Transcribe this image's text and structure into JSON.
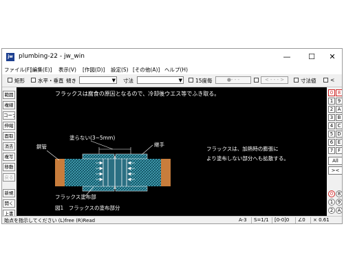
{
  "window": {
    "title": "plumbing-22 - jw_win",
    "icon_label": "jw"
  },
  "window_controls": {
    "minimize": "—",
    "maximize": "☐",
    "close": "✕"
  },
  "menu": [
    "ファイル(F)",
    "[編集(E)]",
    "表示(V)",
    "[作図(D)]",
    "設定(S)",
    "[その他(A)]",
    "ヘルプ(H)"
  ],
  "toolbar": {
    "rect_label": "矩形",
    "horiz_vert_label": "水平・垂直",
    "tilt_label": "傾き",
    "dim_label": "寸法",
    "deg15_label": "15度毎",
    "btn1": "●- - -",
    "btn2": "< - - - >",
    "dim_value_label": "寸法値",
    "lt_label": "<"
  },
  "left_tools": [
    "範囲",
    "複線",
    "コーナー",
    "伸縮",
    "面取",
    "消去",
    "複写",
    "移動",
    "戻る",
    "新規",
    "開く",
    "上書"
  ],
  "right_tools": {
    "top": [
      [
        "0",
        "8"
      ],
      [
        "1",
        "9"
      ],
      [
        "2",
        "A"
      ],
      [
        "3",
        "B"
      ],
      [
        "4",
        "C"
      ],
      [
        "5",
        "D"
      ],
      [
        "6",
        "E"
      ],
      [
        "7",
        "F"
      ]
    ],
    "all_label": "All",
    "x_label": "><",
    "bottom": [
      [
        "0",
        "8"
      ],
      [
        "1",
        "9"
      ],
      [
        "2",
        "A"
      ]
    ]
  },
  "drawing": {
    "heading": "フラックスは腐食の原因となるので、冷却後ウエス等でふき取る。",
    "label_no_coat": "塗らない(3~5mm)",
    "label_copper": "銅管",
    "label_joint": "継手",
    "label_flux_area": "フラックス塗布部",
    "note_line1": "フラックスは、加熱時の膨張に",
    "note_line2": "より塗布しない部分へも拡散する。",
    "caption": "図1　フラックスの塗布部分"
  },
  "status": {
    "prompt": "始点を指示してください (L)free (R)Read",
    "paper": "A-3",
    "scale": "S=1/1",
    "layer": "[0-0]0",
    "angle": "∠0",
    "zoom": "× 0.61"
  }
}
